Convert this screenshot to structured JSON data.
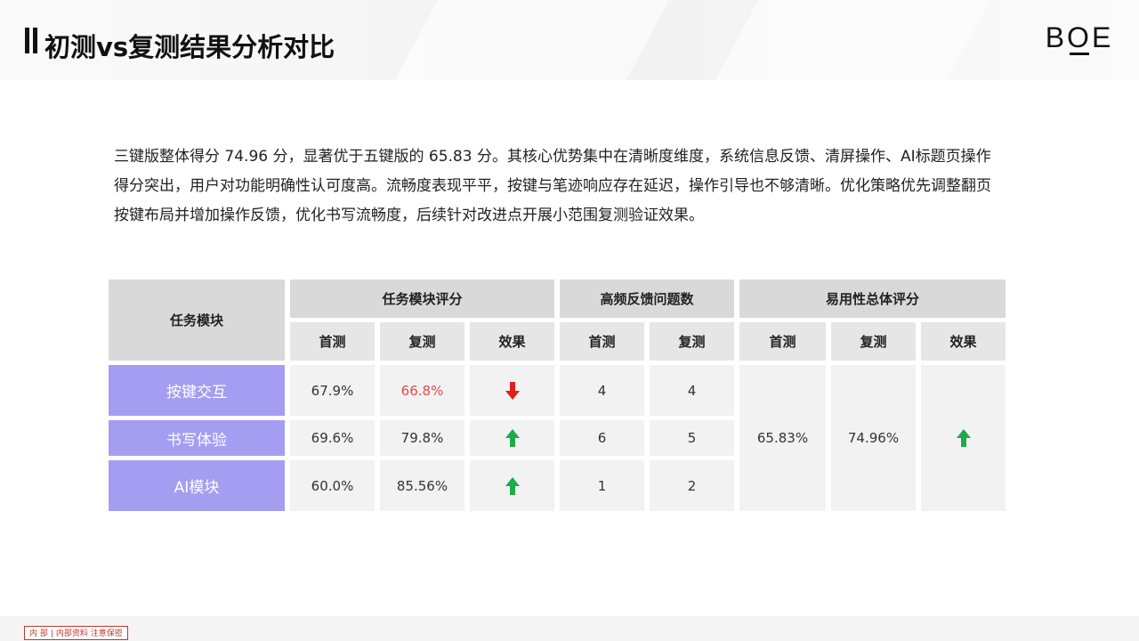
{
  "slide": {
    "title": "初测vs复测结果分析对比",
    "logo": "BOE",
    "summary": "三键版整体得分 74.96 分，显著优于五键版的 65.83 分。其核心优势集中在清晰度维度，系统信息反馈、清屏操作、AI标题页操作得分突出，用户对功能明确性认可度高。流畅度表现平平，按键与笔迹响应存在延迟，操作引导也不够清晰。优化策略优先调整翻页按键布局并增加操作反馈，优化书写流畅度，后续针对改进点开展小范围复测验证效果。"
  },
  "table": {
    "header": {
      "module": "任务模块",
      "group_score": "任务模块评分",
      "group_feedback": "高频反馈问题数",
      "group_overall": "易用性总体评分",
      "first": "首测",
      "retest": "复测",
      "effect": "效果"
    },
    "rows": [
      {
        "module": "按键交互",
        "score_first": "67.9%",
        "score_retest": "66.8%",
        "trend": "down",
        "feedback_first": "4",
        "feedback_retest": "4"
      },
      {
        "module": "书写体验",
        "score_first": "69.6%",
        "score_retest": "79.8%",
        "trend": "up",
        "feedback_first": "6",
        "feedback_retest": "5"
      },
      {
        "module": "AI模块",
        "score_first": "60.0%",
        "score_retest": "85.56%",
        "trend": "up",
        "feedback_first": "1",
        "feedback_retest": "2"
      }
    ],
    "overall": {
      "first": "65.83%",
      "retest": "74.96%",
      "trend": "up"
    }
  },
  "footer": {
    "label_a": "内 部",
    "label_b": "内部资料 注意保密"
  },
  "colors": {
    "module_bg": "#a49ef2",
    "decrease_text": "#e24a4a",
    "arrow_up": "#1faa4b",
    "arrow_down": "#e0201b",
    "footer_tag": "#c0392b"
  }
}
